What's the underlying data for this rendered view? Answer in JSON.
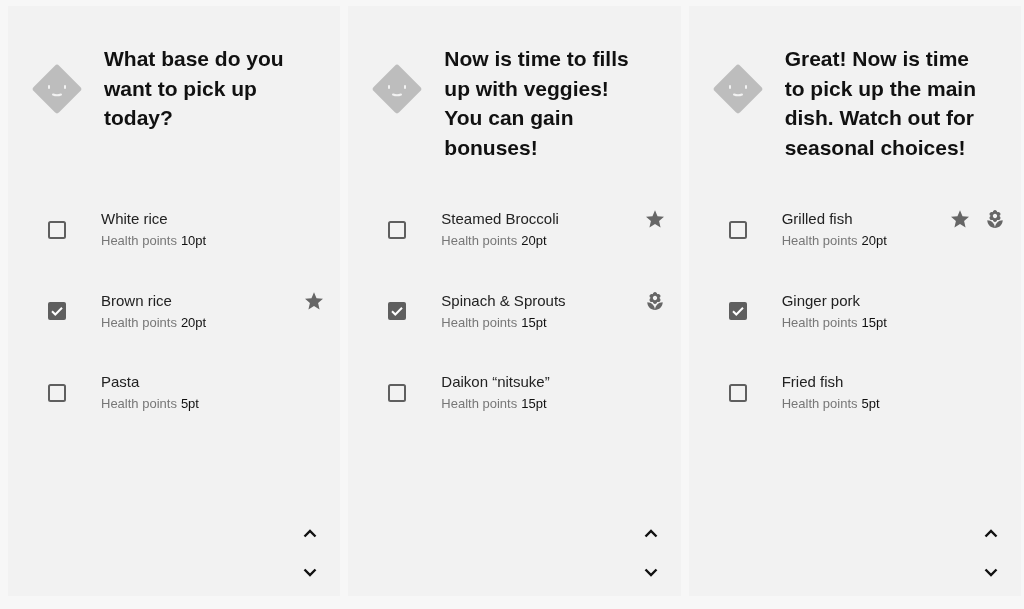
{
  "panels": [
    {
      "title": "What base do you want to pick up today?",
      "items": [
        {
          "name": "White rice",
          "points_label": "Health points",
          "points": "10pt",
          "checked": false,
          "starred": false,
          "seasonal": false
        },
        {
          "name": "Brown rice",
          "points_label": "Health points",
          "points": "20pt",
          "checked": true,
          "starred": true,
          "seasonal": false
        },
        {
          "name": "Pasta",
          "points_label": "Health points",
          "points": "5pt",
          "checked": false,
          "starred": false,
          "seasonal": false
        }
      ]
    },
    {
      "title": "Now is time to fills up with veggies! You can gain bonuses!",
      "items": [
        {
          "name": "Steamed Broccoli",
          "points_label": "Health points",
          "points": "20pt",
          "checked": false,
          "starred": true,
          "seasonal": false
        },
        {
          "name": "Spinach & Sprouts",
          "points_label": "Health points",
          "points": "15pt",
          "checked": true,
          "starred": false,
          "seasonal": true
        },
        {
          "name": "Daikon “nitsuke”",
          "points_label": "Health points",
          "points": "15pt",
          "checked": false,
          "starred": false,
          "seasonal": false
        }
      ]
    },
    {
      "title": "Great! Now is time to pick up the main dish. Watch out for seasonal choices!",
      "items": [
        {
          "name": "Grilled fish",
          "points_label": "Health points",
          "points": "20pt",
          "checked": false,
          "starred": true,
          "seasonal": true
        },
        {
          "name": "Ginger pork",
          "points_label": "Health points",
          "points": "15pt",
          "checked": true,
          "starred": false,
          "seasonal": false
        },
        {
          "name": "Fried fish",
          "points_label": "Health points",
          "points": "5pt",
          "checked": false,
          "starred": false,
          "seasonal": false
        }
      ]
    }
  ]
}
